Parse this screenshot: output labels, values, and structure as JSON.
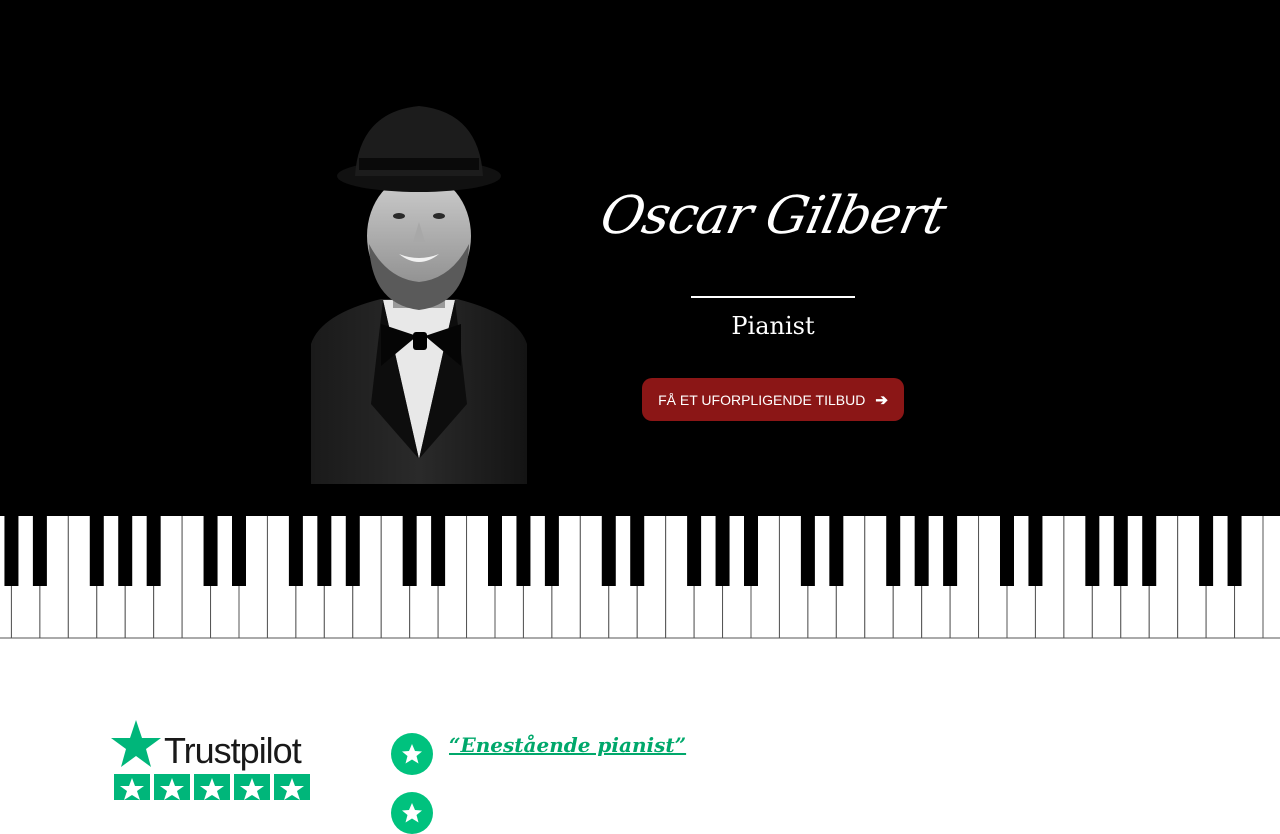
{
  "hero": {
    "name": "Oscar Gilbert",
    "role": "Pianist",
    "cta_label": "FÅ ET UFORPLIGENDE TILBUD",
    "cta_color": "#8b1616"
  },
  "portrait": {
    "alt": "Oscar Gilbert"
  },
  "trustpilot": {
    "wordmark": "Trustpilot",
    "stars": 5,
    "brand_color": "#00b67a"
  },
  "reviews": [
    {
      "quote": "“Enestående pianist”",
      "icon": "star-icon"
    },
    {
      "quote": "",
      "icon": "star-icon"
    }
  ],
  "icons": {
    "cta_arrow": "arrow-right-icon",
    "review": "star-icon",
    "trustpilot": "trustpilot-star-icon"
  }
}
